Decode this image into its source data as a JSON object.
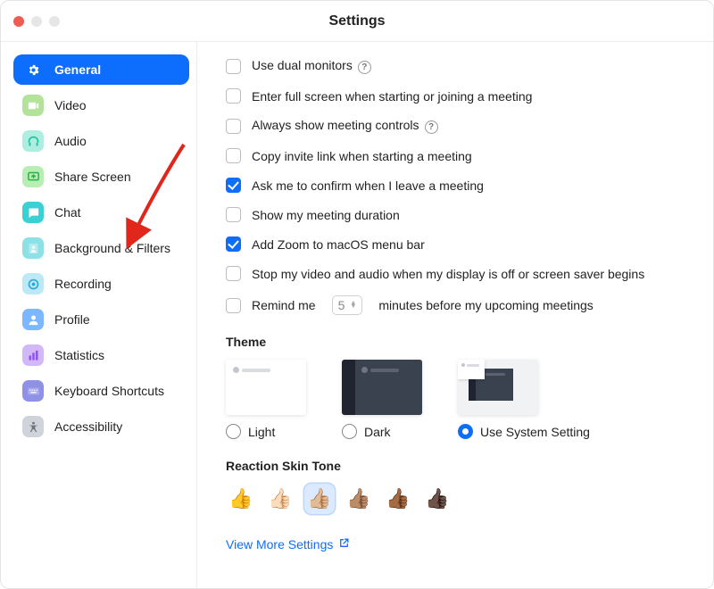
{
  "title": "Settings",
  "sidebar": {
    "items": [
      {
        "label": "General",
        "icon": "gear-icon",
        "bg": "#0d6efd",
        "fg": "#ffffff",
        "active": true
      },
      {
        "label": "Video",
        "icon": "video-icon",
        "bg": "#b3e39a",
        "fg": "#ffffff"
      },
      {
        "label": "Audio",
        "icon": "headphones-icon",
        "bg": "#aeeee0",
        "fg": "#19c39c"
      },
      {
        "label": "Share Screen",
        "icon": "share-screen-icon",
        "bg": "#b8eeb4",
        "fg": "#27b34b"
      },
      {
        "label": "Chat",
        "icon": "chat-icon",
        "bg": "#39d1d3",
        "fg": "#ffffff"
      },
      {
        "label": "Background & Filters",
        "icon": "portrait-icon",
        "bg": "#8de0e6",
        "fg": "#ffffff"
      },
      {
        "label": "Recording",
        "icon": "record-icon",
        "bg": "#bde8f5",
        "fg": "#2aa8d6"
      },
      {
        "label": "Profile",
        "icon": "profile-icon",
        "bg": "#7db7ff",
        "fg": "#ffffff"
      },
      {
        "label": "Statistics",
        "icon": "statistics-icon",
        "bg": "#d2b8f7",
        "fg": "#8e55e6"
      },
      {
        "label": "Keyboard Shortcuts",
        "icon": "keyboard-icon",
        "bg": "#8e91e6",
        "fg": "#ffffff"
      },
      {
        "label": "Accessibility",
        "icon": "accessibility-icon",
        "bg": "#cfd4db",
        "fg": "#6b7280"
      }
    ]
  },
  "options": [
    {
      "label": "Use dual monitors",
      "checked": false,
      "info": true
    },
    {
      "label": "Enter full screen when starting or joining a meeting",
      "checked": false
    },
    {
      "label": "Always show meeting controls",
      "checked": false,
      "info": true
    },
    {
      "label": "Copy invite link when starting a meeting",
      "checked": false
    },
    {
      "label": "Ask me to confirm when I leave a meeting",
      "checked": true
    },
    {
      "label": "Show my meeting duration",
      "checked": false
    },
    {
      "label": "Add Zoom to macOS menu bar",
      "checked": true
    },
    {
      "label": "Stop my video and audio when my display is off or screen saver begins",
      "checked": false
    }
  ],
  "remind": {
    "prefix": "Remind me",
    "value": "5",
    "suffix": "minutes before my upcoming meetings",
    "checked": false
  },
  "theme": {
    "title": "Theme",
    "options": [
      {
        "label": "Light",
        "selected": false
      },
      {
        "label": "Dark",
        "selected": false
      },
      {
        "label": "Use System Setting",
        "selected": true
      }
    ]
  },
  "skin": {
    "title": "Reaction Skin Tone",
    "tones": [
      "👍",
      "👍🏻",
      "👍🏼",
      "👍🏽",
      "👍🏾",
      "👍🏿"
    ],
    "selected_index": 2
  },
  "view_more": "View More Settings"
}
